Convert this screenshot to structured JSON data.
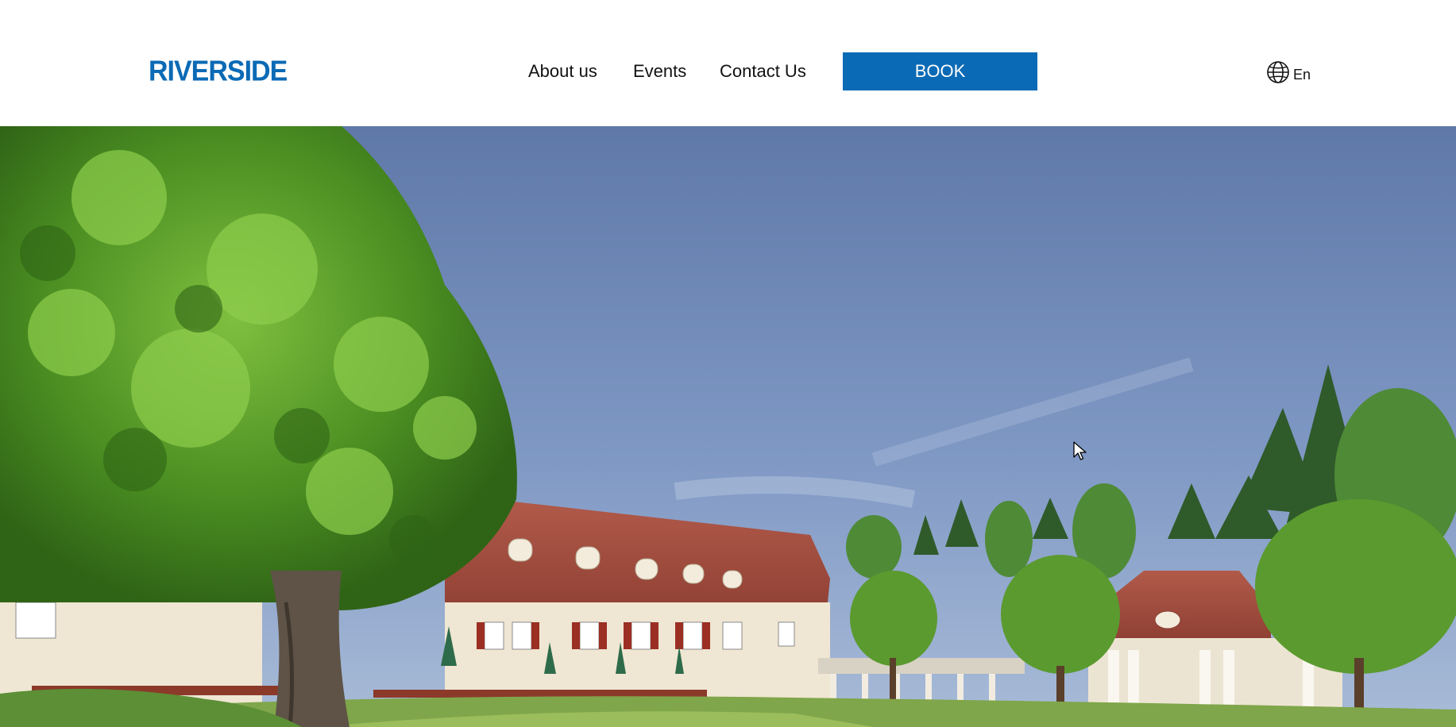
{
  "header": {
    "logo_text": "RIVERSIDE",
    "nav": [
      {
        "label": "About us"
      },
      {
        "label": "Events"
      },
      {
        "label": "Contact Us"
      }
    ],
    "book_label": "BOOK",
    "language_label": "En"
  },
  "hero": {
    "image_description_icon": "hotel-photo"
  },
  "colors": {
    "brand": "#0b6ab5",
    "text": "#111111",
    "background": "#ffffff"
  }
}
